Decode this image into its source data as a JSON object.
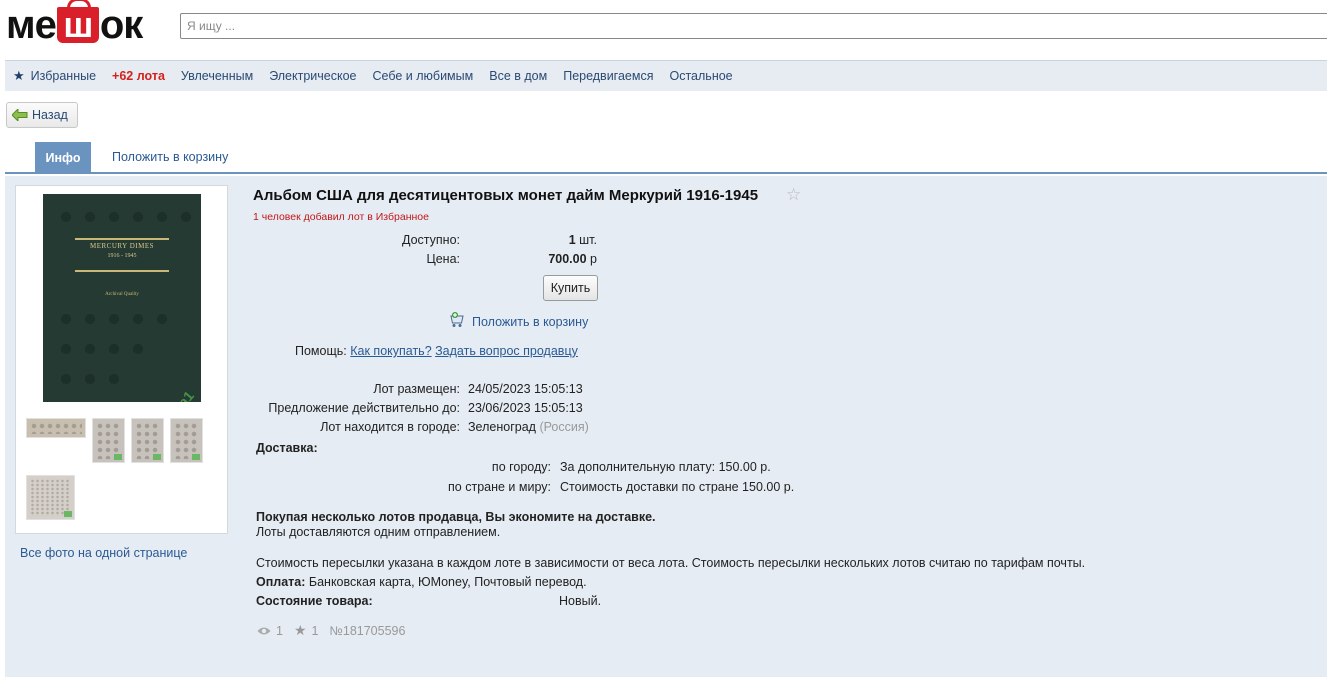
{
  "header": {
    "logo_text_left": "ме",
    "logo_text_bag": "ш",
    "logo_text_right": "ок",
    "search_placeholder": "Я ищу ..."
  },
  "nav": {
    "items": [
      "Избранные",
      "+62 лота",
      "Увлеченным",
      "Электрическое",
      "Себе и любимым",
      "Все в дом",
      "Передвигаемся",
      "Остальное"
    ]
  },
  "back_label": "Назад",
  "tabs": {
    "info": "Инфо",
    "cart": "Положить в корзину"
  },
  "gallery": {
    "photo_title1": "MERCURY DIMES",
    "photo_title2": "1916 - 1945",
    "photo_title3": "Archival Quality",
    "watermark": "Лизочка1",
    "all_photos": "Все фото на одной странице"
  },
  "lot": {
    "title": "Альбом США для десятицентовых монет дайм Меркурий 1916-1945",
    "favorites_note": "1 человек добавил лот в Избранное",
    "available_label": "Доступно:",
    "available_value": "1",
    "available_unit": "шт.",
    "price_label": "Цена:",
    "price_value": "700.00",
    "price_unit": "р",
    "buy_label": "Купить",
    "cart_label": "Положить в корзину",
    "help_label": "Помощь:",
    "help_how": "Как покупать?",
    "help_ask": "Задать вопрос продавцу",
    "placed_label": "Лот размещен:",
    "placed_value": "24/05/2023 15:05:13",
    "valid_label": "Предложение действительно до:",
    "valid_value": "23/06/2023 15:05:13",
    "city_label": "Лот находится в городе:",
    "city_value": "Зеленоград",
    "country_value": "(Россия)",
    "delivery_label": "Доставка:",
    "delivery_city_label": "по городу:",
    "delivery_city_value": "За дополнительную плату: 150.00 р.",
    "delivery_country_label": "по стране и миру:",
    "delivery_country_value": "Стоимость доставки по стране 150.00 р.",
    "savings_bold": "Покупая несколько лотов продавца, Вы экономите на доставке.",
    "savings_note": "Лоты доставляются одним отправлением.",
    "shipping_note": "Стоимость пересылки указана в каждом лоте в зависимости от веса лота. Стоимость пересылки нескольких лотов считаю по тарифам почты.",
    "payment_label": "Оплата:",
    "payment_value": "Банковская карта, ЮMoney, Почтовый перевод.",
    "condition_label": "Состояние товара:",
    "condition_value": "Новый.",
    "views": "1",
    "stars": "1",
    "lot_number": "№181705596"
  },
  "colors": {
    "accent": "#6b93c0",
    "panel": "#e6ecf4",
    "logo_red": "#d9202a",
    "nav_hot": "#d3211d"
  }
}
